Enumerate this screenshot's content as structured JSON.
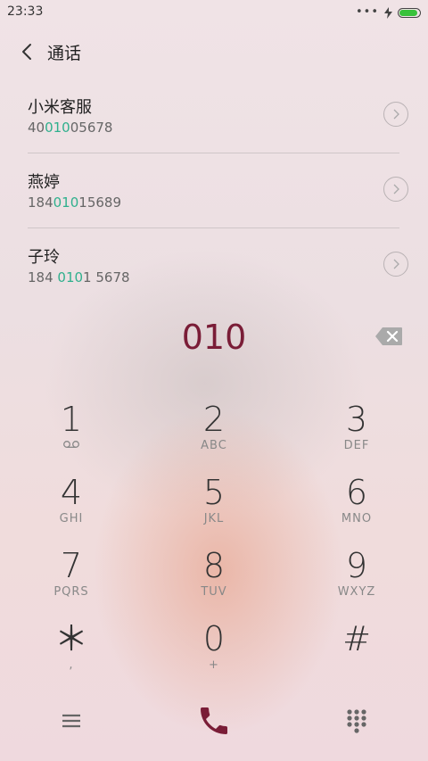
{
  "status_bar": {
    "time": "23:33",
    "more": "•••",
    "charging_icon": "lightning-icon"
  },
  "header": {
    "title": "通话"
  },
  "results": [
    {
      "name": "小米客服",
      "num_pre": "40",
      "num_hl": "010",
      "num_post": "05678"
    },
    {
      "name": "燕婷",
      "num_pre": "184",
      "num_hl": "010",
      "num_post": "15689"
    },
    {
      "name": "子玲",
      "num_pre": "184 ",
      "num_hl": "010",
      "num_post": "1 5678"
    }
  ],
  "dialed": "010",
  "keypad": [
    [
      {
        "digit": "1",
        "sub": ""
      },
      {
        "digit": "2",
        "sub": "ABC"
      },
      {
        "digit": "3",
        "sub": "DEF"
      }
    ],
    [
      {
        "digit": "4",
        "sub": "GHI"
      },
      {
        "digit": "5",
        "sub": "JKL"
      },
      {
        "digit": "6",
        "sub": "MNO"
      }
    ],
    [
      {
        "digit": "7",
        "sub": "PQRS"
      },
      {
        "digit": "8",
        "sub": "TUV"
      },
      {
        "digit": "9",
        "sub": "WXYZ"
      }
    ],
    [
      {
        "digit": "＊",
        "sub": ","
      },
      {
        "digit": "0",
        "sub": "+"
      },
      {
        "digit": "#",
        "sub": ""
      }
    ]
  ],
  "colors": {
    "accent": "#7a1d37",
    "highlight": "#2fb08d",
    "battery": "#39c23b"
  }
}
